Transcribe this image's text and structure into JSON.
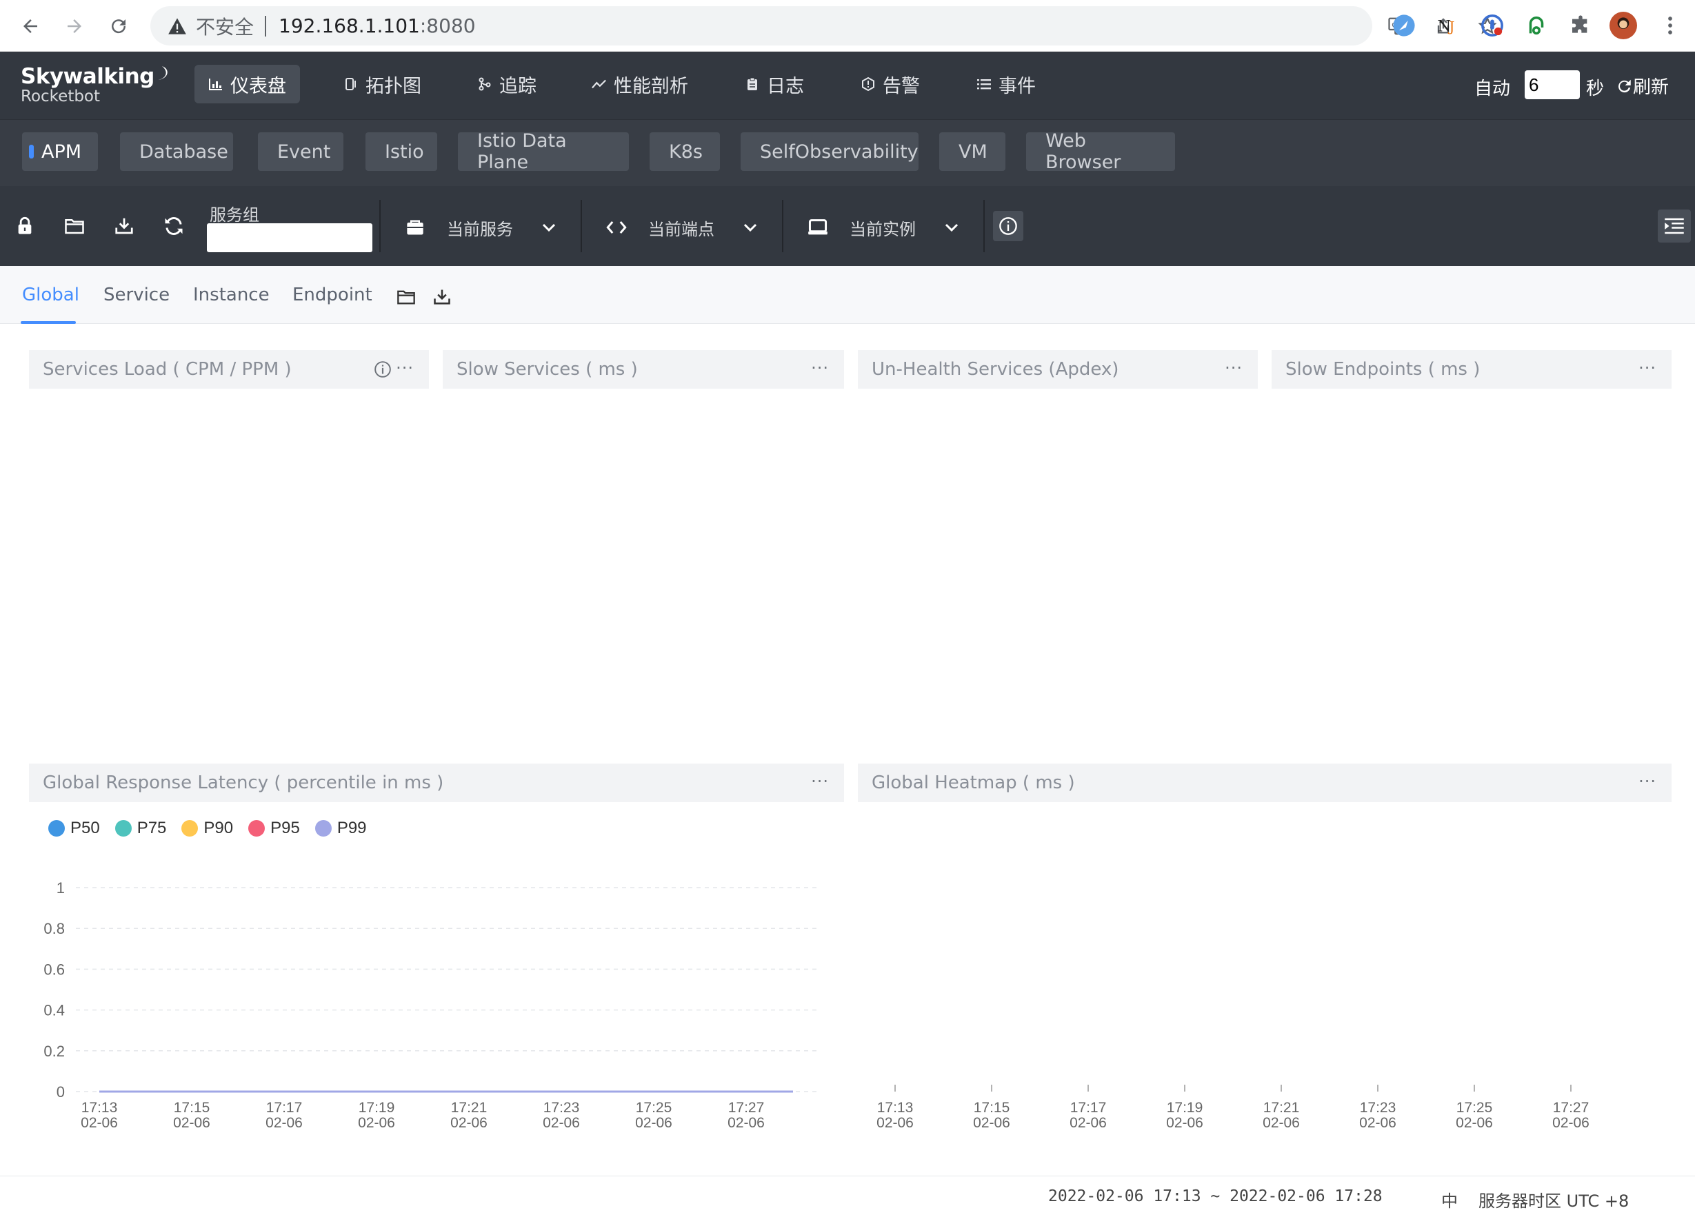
{
  "browser": {
    "insecure_label": "不安全",
    "url_host": "192.168.1.101",
    "url_port": ":8080"
  },
  "logo": {
    "line1": "Skywalking",
    "line2": "Rocketbot"
  },
  "nav": [
    {
      "label": "仪表盘",
      "icon": "dashboard-icon"
    },
    {
      "label": "拓扑图",
      "icon": "topology-icon"
    },
    {
      "label": "追踪",
      "icon": "trace-icon"
    },
    {
      "label": "性能剖析",
      "icon": "profile-icon"
    },
    {
      "label": "日志",
      "icon": "log-icon"
    },
    {
      "label": "告警",
      "icon": "alarm-icon"
    },
    {
      "label": "事件",
      "icon": "event-list-icon"
    }
  ],
  "auto": {
    "label": "自动",
    "value": "6",
    "unit": "秒",
    "refresh": "刷新"
  },
  "templates": [
    "APM",
    "Database",
    "Event",
    "Istio",
    "Istio Data Plane",
    "K8s",
    "SelfObservability",
    "VM",
    "Web Browser"
  ],
  "toolbar": {
    "service_group_label": "服务组",
    "current_service": "当前服务",
    "current_endpoint": "当前端点",
    "current_instance": "当前实例"
  },
  "subtabs": [
    "Global",
    "Service",
    "Instance",
    "Endpoint"
  ],
  "panels": {
    "services_load": "Services Load ( CPM / PPM )",
    "slow_services": "Slow Services ( ms )",
    "unhealth_services": "Un-Health Services (Apdex)",
    "slow_endpoints": "Slow Endpoints ( ms )",
    "latency": "Global Response Latency ( percentile in ms )",
    "heatmap": "Global Heatmap ( ms )",
    "more": "···"
  },
  "chart_data": [
    {
      "type": "line",
      "title": "Global Response Latency ( percentile in ms )",
      "categories": [
        "17:13\n02-06",
        "17:15\n02-06",
        "17:17\n02-06",
        "17:19\n02-06",
        "17:21\n02-06",
        "17:23\n02-06",
        "17:25\n02-06",
        "17:27\n02-06"
      ],
      "x_ticks_time": [
        "17:13",
        "17:15",
        "17:17",
        "17:19",
        "17:21",
        "17:23",
        "17:25",
        "17:27"
      ],
      "x_ticks_date": [
        "02-06",
        "02-06",
        "02-06",
        "02-06",
        "02-06",
        "02-06",
        "02-06",
        "02-06"
      ],
      "y_ticks": [
        "0",
        "0.2",
        "0.4",
        "0.6",
        "0.8",
        "1"
      ],
      "ylim": [
        0,
        1
      ],
      "grid": true,
      "legend_position": "top-left",
      "series": [
        {
          "name": "P50",
          "color": "#3f96e3",
          "values": [
            0,
            0,
            0,
            0,
            0,
            0,
            0,
            0,
            0,
            0,
            0,
            0,
            0,
            0,
            0,
            0
          ]
        },
        {
          "name": "P75",
          "color": "#4ec3bd",
          "values": [
            0,
            0,
            0,
            0,
            0,
            0,
            0,
            0,
            0,
            0,
            0,
            0,
            0,
            0,
            0,
            0
          ]
        },
        {
          "name": "P90",
          "color": "#ffc750",
          "values": [
            0,
            0,
            0,
            0,
            0,
            0,
            0,
            0,
            0,
            0,
            0,
            0,
            0,
            0,
            0,
            0
          ]
        },
        {
          "name": "P95",
          "color": "#f45f78",
          "values": [
            0,
            0,
            0,
            0,
            0,
            0,
            0,
            0,
            0,
            0,
            0,
            0,
            0,
            0,
            0,
            0
          ]
        },
        {
          "name": "P99",
          "color": "#a0a7e6",
          "values": [
            0,
            0,
            0,
            0,
            0,
            0,
            0,
            0,
            0,
            0,
            0,
            0,
            0,
            0,
            0,
            0
          ]
        }
      ]
    },
    {
      "type": "heatmap",
      "title": "Global Heatmap ( ms )",
      "x_ticks_time": [
        "17:13",
        "17:15",
        "17:17",
        "17:19",
        "17:21",
        "17:23",
        "17:25",
        "17:27"
      ],
      "x_ticks_date": [
        "02-06",
        "02-06",
        "02-06",
        "02-06",
        "02-06",
        "02-06",
        "02-06",
        "02-06"
      ],
      "values": []
    }
  ],
  "footer": {
    "time_range": "2022-02-06 17:13 ~ 2022-02-06 17:28",
    "lang": "中",
    "timezone": "服务器时区 UTC +8"
  }
}
